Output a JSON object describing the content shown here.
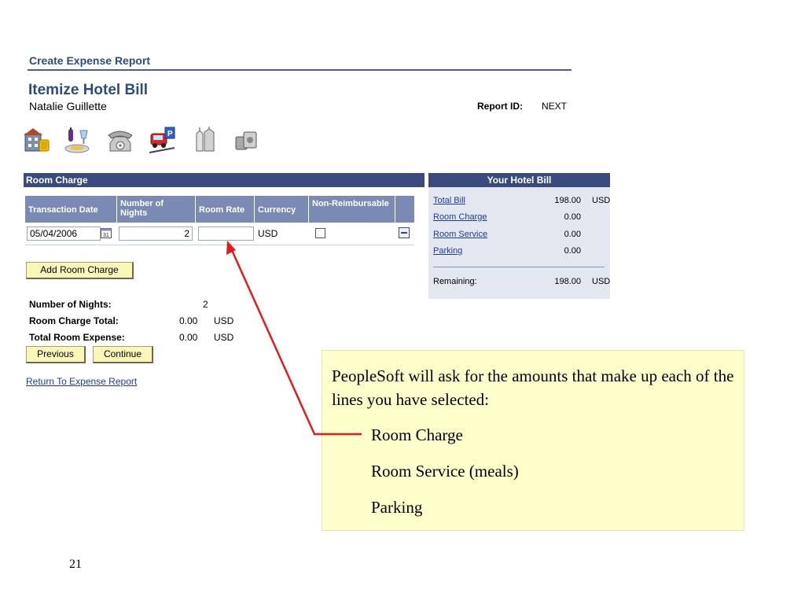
{
  "header": {
    "breadcrumb": "Create Expense Report",
    "title": "Itemize Hotel Bill",
    "user": "Natalie Guillette",
    "report_id_label": "Report ID:",
    "report_id_value": "NEXT"
  },
  "toolbar": {
    "icons": [
      "hotel-icon",
      "meals-icon",
      "telephone-icon",
      "parking-icon",
      "laundry-icon",
      "miscellaneous-icon"
    ]
  },
  "room_charge": {
    "section_title": "Room Charge",
    "columns": [
      "Transaction Date",
      "Number of Nights",
      "Room Rate",
      "Currency",
      "Non-Reimbursable"
    ],
    "row": {
      "transaction_date": "05/04/2006",
      "nights": "2",
      "room_rate": "",
      "currency": "USD",
      "non_reimbursable": false
    },
    "add_button": "Add Room Charge",
    "summary": {
      "nights_label": "Number of Nights:",
      "nights_value": "2",
      "room_total_label": "Room Charge Total:",
      "room_total_value": "0.00",
      "room_total_currency": "USD",
      "total_expense_label": "Total Room Expense:",
      "total_expense_value": "0.00",
      "total_expense_currency": "USD"
    },
    "previous_button": "Previous",
    "continue_button": "Continue",
    "return_link": "Return To Expense Report"
  },
  "hotel_bill": {
    "title": "Your Hotel Bill",
    "rows": [
      {
        "label": "Total Bill",
        "amount": "198.00",
        "currency": "USD"
      },
      {
        "label": "Room Charge",
        "amount": "0.00",
        "currency": ""
      },
      {
        "label": "Room Service",
        "amount": "0.00",
        "currency": ""
      },
      {
        "label": "Parking",
        "amount": "0.00",
        "currency": ""
      }
    ],
    "remaining_label": "Remaining:",
    "remaining_amount": "198.00",
    "remaining_currency": "USD"
  },
  "callout": {
    "intro": "PeopleSoft will ask for the amounts that make up each of the lines you have selected:",
    "items": [
      "Room Charge",
      "Room Service (meals)",
      "Parking"
    ]
  },
  "slide_number": "21",
  "colors": {
    "header_bar": "#3a4a7c",
    "column_header": "#7b8ab5",
    "button_bg": "#fbf7b8",
    "callout_bg": "#ffffcc",
    "arrow": "#e41b1b",
    "title_text": "#2e4a7f"
  }
}
